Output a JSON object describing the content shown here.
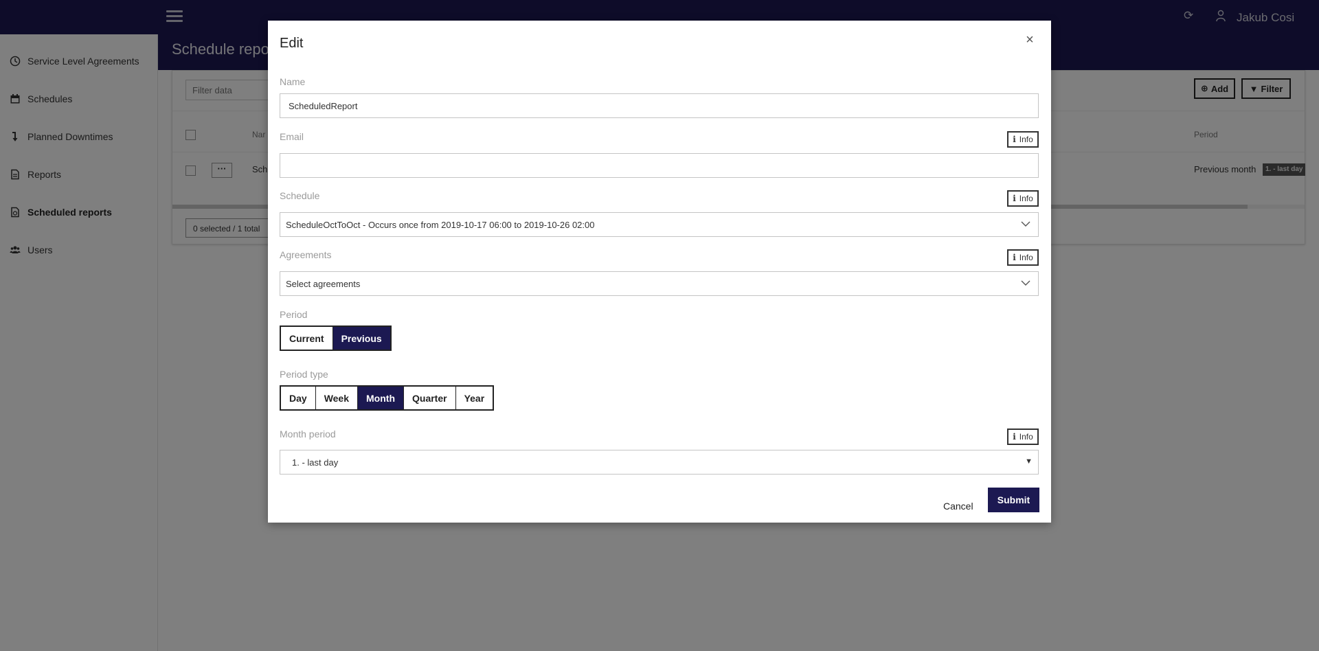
{
  "header": {
    "user_name": "Jakub Cosi",
    "icons": [
      "hamburger-icon",
      "refresh-icon",
      "user-icon"
    ]
  },
  "sidebar": {
    "items": [
      {
        "label": "Service Level Agreements",
        "icon": "clock-icon"
      },
      {
        "label": "Schedules",
        "icon": "calendar-icon"
      },
      {
        "label": "Planned Downtimes",
        "icon": "arrow-down-icon"
      },
      {
        "label": "Reports",
        "icon": "document-icon"
      },
      {
        "label": "Scheduled reports",
        "icon": "scheduled-report-icon",
        "active": true
      },
      {
        "label": "Users",
        "icon": "users-icon"
      }
    ]
  },
  "page": {
    "title": "Schedule repor",
    "filter_placeholder": "Filter data",
    "add_label": "Add",
    "filter_label": "Filter",
    "table": {
      "name_header": "Nar",
      "period_header": "Period",
      "row": {
        "menu": "···",
        "name": "Sch",
        "period": "Previous month",
        "badge": "1. - last day"
      }
    },
    "footer_count": "0 selected / 1 total"
  },
  "modal": {
    "title": "Edit",
    "close": "×",
    "info_label": "Info",
    "name": {
      "label": "Name",
      "value": "ScheduledReport"
    },
    "email": {
      "label": "Email",
      "value": ""
    },
    "schedule": {
      "label": "Schedule",
      "value": "ScheduleOctToOct - Occurs once from 2019-10-17 06:00 to 2019-10-26 02:00"
    },
    "agreements": {
      "label": "Agreements",
      "value": "Select agreements"
    },
    "period": {
      "label": "Period",
      "options": [
        "Current",
        "Previous"
      ],
      "selected": "Previous"
    },
    "period_type": {
      "label": "Period type",
      "options": [
        "Day",
        "Week",
        "Month",
        "Quarter",
        "Year"
      ],
      "selected": "Month"
    },
    "month_period": {
      "label": "Month period",
      "value": "1. - last day"
    },
    "cancel_label": "Cancel",
    "submit_label": "Submit"
  },
  "colors": {
    "brand": "#1c1952",
    "overlay": "rgba(0,0,0,0.5)"
  }
}
